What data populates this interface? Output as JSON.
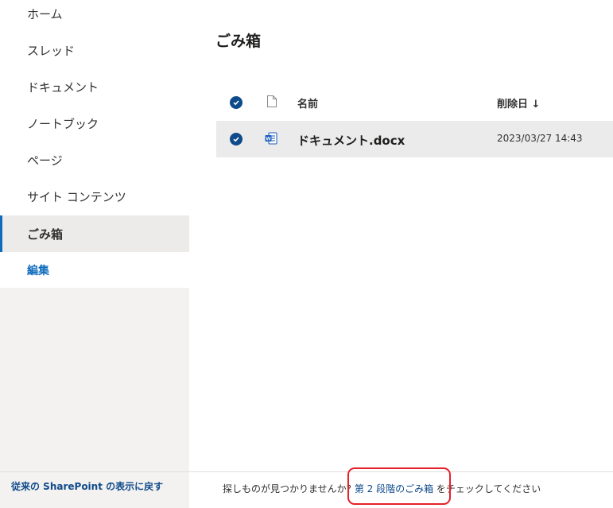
{
  "sidebar": {
    "items": [
      {
        "label": "ホーム"
      },
      {
        "label": "スレッド"
      },
      {
        "label": "ドキュメント"
      },
      {
        "label": "ノートブック"
      },
      {
        "label": "ページ"
      },
      {
        "label": "サイト コンテンツ"
      },
      {
        "label": "ごみ箱",
        "selected": true
      }
    ],
    "edit_label": "編集",
    "classic_link": "従来の SharePoint の表示に戻す"
  },
  "main": {
    "title": "ごみ箱",
    "columns": {
      "name": "名前",
      "deleted_date": "削除日 ↓"
    },
    "rows": [
      {
        "name": "ドキュメント.docx",
        "deleted_date": "2023/03/27 14:43",
        "icon": "word-doc-icon",
        "selected": true
      }
    ],
    "footer": {
      "prefix": "探しものが見つかりませんか? ",
      "link": "第 2 段階のごみ箱",
      "suffix": " をチェックしてください"
    }
  },
  "colors": {
    "accent": "#0f4a8a",
    "highlight": "#e6202a",
    "selected_row": "#ebebeb"
  }
}
